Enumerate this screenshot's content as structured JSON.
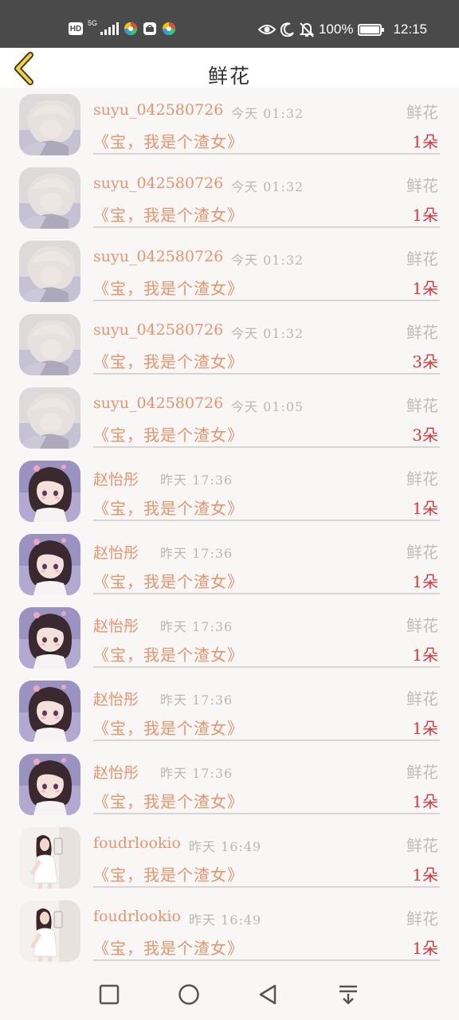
{
  "status_bar": {
    "hd": "HD",
    "network": "5G",
    "battery_percent": "100%",
    "time": "12:15"
  },
  "header": {
    "title": "鲜花",
    "back_icon": "chevron-left-icon"
  },
  "rows": [
    {
      "username": "suyu_042580726",
      "time": "今天 01:32",
      "gift": "鲜花",
      "message": "《宝，我是个渣女》",
      "count": "1朵",
      "avatar": "boy"
    },
    {
      "username": "suyu_042580726",
      "time": "今天 01:32",
      "gift": "鲜花",
      "message": "《宝，我是个渣女》",
      "count": "1朵",
      "avatar": "boy"
    },
    {
      "username": "suyu_042580726",
      "time": "今天 01:32",
      "gift": "鲜花",
      "message": "《宝，我是个渣女》",
      "count": "1朵",
      "avatar": "boy"
    },
    {
      "username": "suyu_042580726",
      "time": "今天 01:32",
      "gift": "鲜花",
      "message": "《宝，我是个渣女》",
      "count": "3朵",
      "avatar": "boy"
    },
    {
      "username": "suyu_042580726",
      "time": "今天 01:05",
      "gift": "鲜花",
      "message": "《宝，我是个渣女》",
      "count": "3朵",
      "avatar": "boy"
    },
    {
      "username": "赵怡彤",
      "time": "昨天 17:36",
      "gift": "鲜花",
      "message": "《宝，我是个渣女》",
      "count": "1朵",
      "avatar": "girl"
    },
    {
      "username": "赵怡彤",
      "time": "昨天 17:36",
      "gift": "鲜花",
      "message": "《宝，我是个渣女》",
      "count": "1朵",
      "avatar": "girl"
    },
    {
      "username": "赵怡彤",
      "time": "昨天 17:36",
      "gift": "鲜花",
      "message": "《宝，我是个渣女》",
      "count": "1朵",
      "avatar": "girl"
    },
    {
      "username": "赵怡彤",
      "time": "昨天 17:36",
      "gift": "鲜花",
      "message": "《宝，我是个渣女》",
      "count": "1朵",
      "avatar": "girl"
    },
    {
      "username": "赵怡彤",
      "time": "昨天 17:36",
      "gift": "鲜花",
      "message": "《宝，我是个渣女》",
      "count": "1朵",
      "avatar": "girl"
    },
    {
      "username": "foudrlookio",
      "time": "昨天 16:49",
      "gift": "鲜花",
      "message": "《宝，我是个渣女》",
      "count": "1朵",
      "avatar": "photo"
    },
    {
      "username": "foudrlookio",
      "time": "昨天 16:49",
      "gift": "鲜花",
      "message": "《宝，我是个渣女》",
      "count": "1朵",
      "avatar": "photo"
    }
  ],
  "nav_bar": {
    "icons": [
      "square-recents-icon",
      "circle-home-icon",
      "triangle-back-icon",
      "download-menu-icon"
    ]
  },
  "colors": {
    "accent": "#e8956c",
    "count": "#d9383b",
    "muted": "#b8b8b8",
    "status_bar": "#4a4a4a"
  }
}
